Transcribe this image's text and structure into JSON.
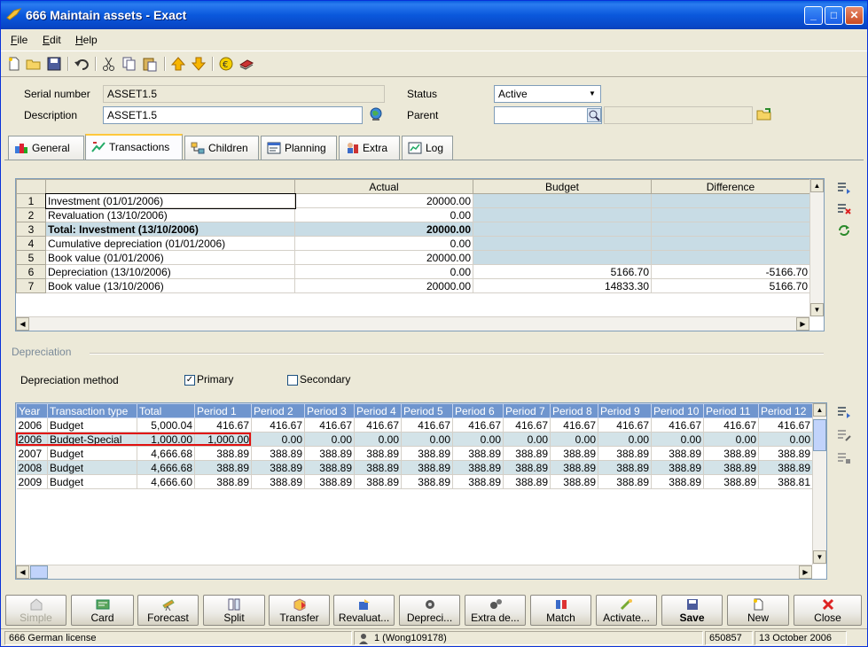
{
  "window": {
    "title": "666 Maintain assets - Exact",
    "minimize": "_",
    "maximize": "□",
    "close": "✕"
  },
  "menu": {
    "file": "File",
    "edit": "Edit",
    "help": "Help"
  },
  "header": {
    "serial_label": "Serial number",
    "serial_value": "ASSET1.5",
    "description_label": "Description",
    "description_value": "ASSET1.5",
    "status_label": "Status",
    "status_value": "Active",
    "parent_label": "Parent",
    "parent_value": ""
  },
  "tabs": [
    {
      "label": "General",
      "icon": "general-icon"
    },
    {
      "label": "Transactions",
      "icon": "transactions-icon"
    },
    {
      "label": "Children",
      "icon": "children-icon"
    },
    {
      "label": "Planning",
      "icon": "planning-icon"
    },
    {
      "label": "Extra",
      "icon": "extra-icon"
    },
    {
      "label": "Log",
      "icon": "log-icon"
    }
  ],
  "transactions": {
    "columns": [
      "Actual",
      "Budget",
      "Difference"
    ],
    "rows": [
      {
        "n": "1",
        "label": "Investment (01/01/2006)",
        "actual": "20000.00",
        "budget": "",
        "diff": ""
      },
      {
        "n": "2",
        "label": "Revaluation (13/10/2006)",
        "actual": "0.00",
        "budget": "",
        "diff": ""
      },
      {
        "n": "3",
        "label": "Total: Investment (13/10/2006)",
        "actual": "20000.00",
        "budget": "",
        "diff": ""
      },
      {
        "n": "4",
        "label": "Cumulative depreciation (01/01/2006)",
        "actual": "0.00",
        "budget": "",
        "diff": ""
      },
      {
        "n": "5",
        "label": "Book value (01/01/2006)",
        "actual": "20000.00",
        "budget": "",
        "diff": ""
      },
      {
        "n": "6",
        "label": "Depreciation (13/10/2006)",
        "actual": "0.00",
        "budget": "5166.70",
        "diff": "-5166.70"
      },
      {
        "n": "7",
        "label": "Book value (13/10/2006)",
        "actual": "20000.00",
        "budget": "14833.30",
        "diff": "5166.70"
      }
    ]
  },
  "depreciation": {
    "section_title": "Depreciation",
    "method_label": "Depreciation method",
    "primary_label": "Primary",
    "primary_checked": "✓",
    "secondary_label": "Secondary",
    "columns": [
      "Year",
      "Transaction type",
      "Total",
      "Period 1",
      "Period 2",
      "Period 3",
      "Period 4",
      "Period 5",
      "Period 6",
      "Period 7",
      "Period 8",
      "Period 9",
      "Period 10",
      "Period 11",
      "Period 12"
    ],
    "rows": [
      [
        "2006",
        "Budget",
        "5,000.04",
        "416.67",
        "416.67",
        "416.67",
        "416.67",
        "416.67",
        "416.67",
        "416.67",
        "416.67",
        "416.67",
        "416.67",
        "416.67",
        "416.67"
      ],
      [
        "2006",
        "Budget-Special",
        "1,000.00",
        "1,000.00",
        "0.00",
        "0.00",
        "0.00",
        "0.00",
        "0.00",
        "0.00",
        "0.00",
        "0.00",
        "0.00",
        "0.00",
        "0.00"
      ],
      [
        "2007",
        "Budget",
        "4,666.68",
        "388.89",
        "388.89",
        "388.89",
        "388.89",
        "388.89",
        "388.89",
        "388.89",
        "388.89",
        "388.89",
        "388.89",
        "388.89",
        "388.89"
      ],
      [
        "2008",
        "Budget",
        "4,666.68",
        "388.89",
        "388.89",
        "388.89",
        "388.89",
        "388.89",
        "388.89",
        "388.89",
        "388.89",
        "388.89",
        "388.89",
        "388.89",
        "388.89"
      ],
      [
        "2009",
        "Budget",
        "4,666.60",
        "388.89",
        "388.89",
        "388.89",
        "388.89",
        "388.89",
        "388.89",
        "388.89",
        "388.89",
        "388.89",
        "388.89",
        "388.89",
        "388.81"
      ]
    ]
  },
  "buttons": {
    "simple": "Simple",
    "card": "Card",
    "forecast": "Forecast",
    "split": "Split",
    "transfer": "Transfer",
    "revaluate": "Revaluat...",
    "depreciate": "Depreci...",
    "extra_depreciation": "Extra de...",
    "match": "Match",
    "activate": "Activate...",
    "save": "Save",
    "new": "New",
    "close": "Close"
  },
  "status": {
    "license": "666 German license",
    "user": "1 (Wong109178)",
    "code": "650857",
    "date": "13 October 2006"
  },
  "colors": {
    "accent": "#0a58dc",
    "grid_header": "#6f95ce",
    "highlight": "#e01010",
    "shade": "#c8dce5"
  }
}
